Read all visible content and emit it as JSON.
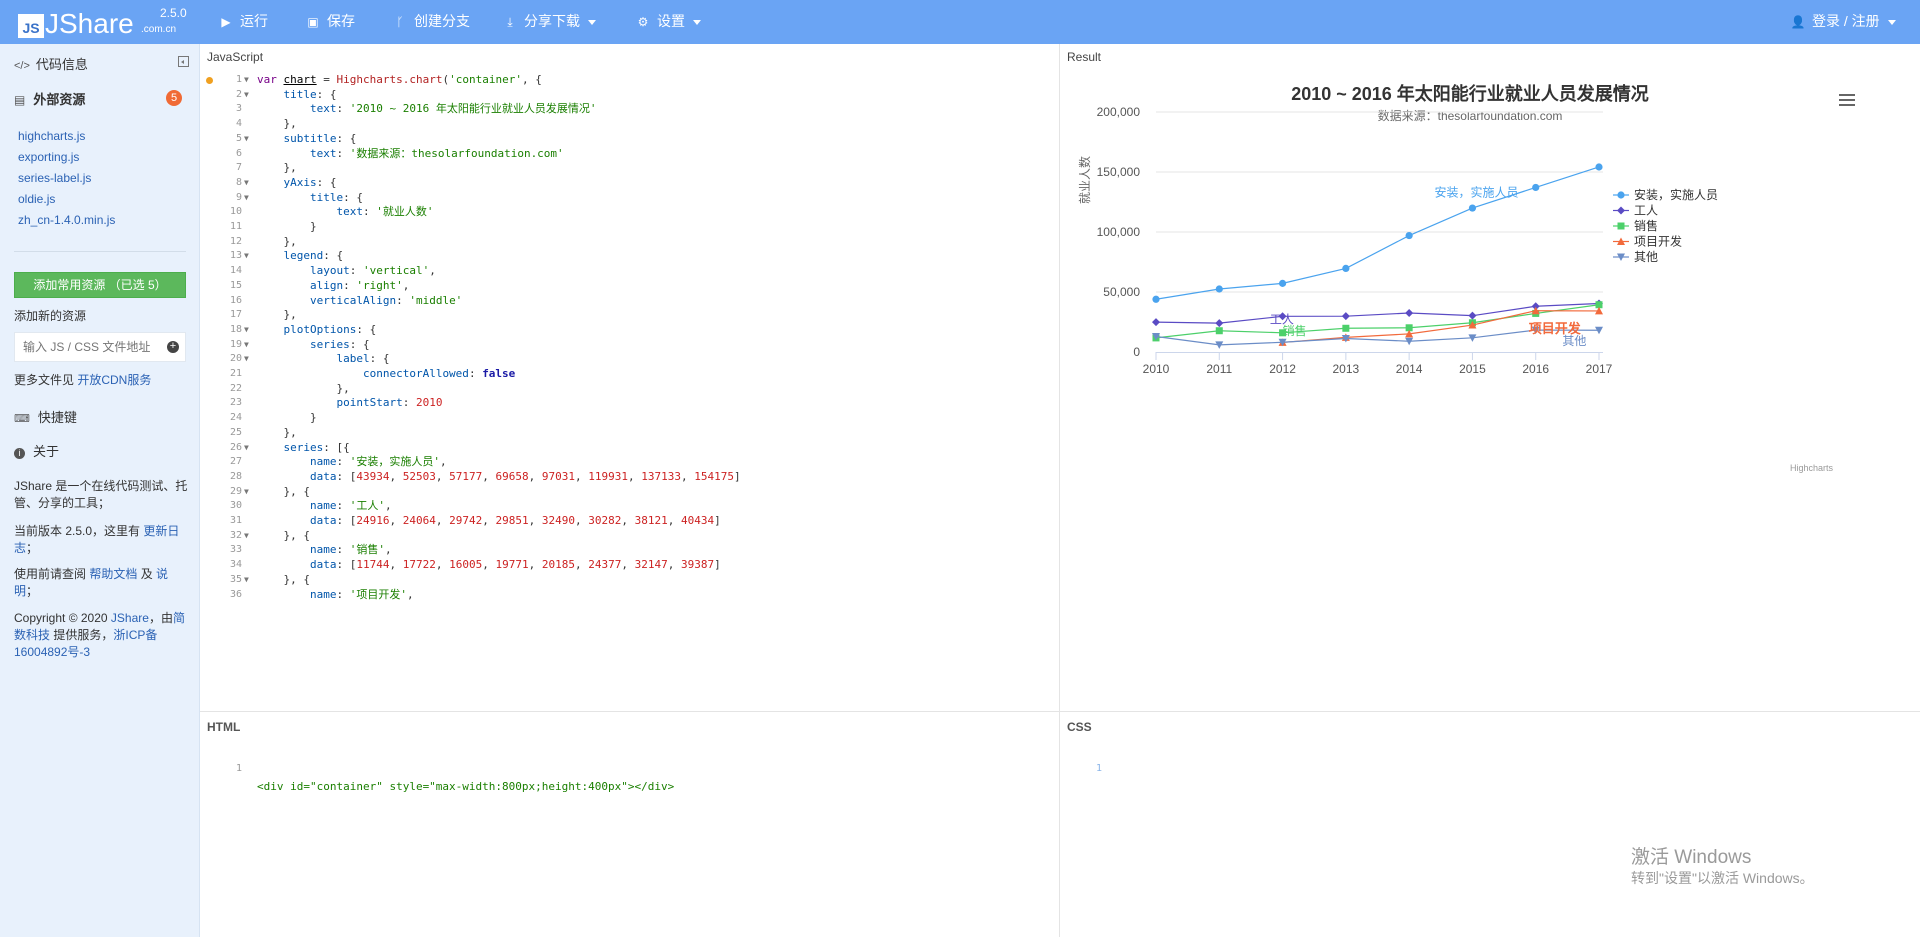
{
  "header": {
    "logo_box": "JS",
    "logo_name": "JShare",
    "logo_domain": ".com.cn",
    "version": "2.5.0",
    "nav": [
      {
        "label": "运行",
        "icon": "play-icon"
      },
      {
        "label": "保存",
        "icon": "save-icon"
      },
      {
        "label": "创建分支",
        "icon": "fork-icon"
      },
      {
        "label": "分享下载",
        "icon": "download-icon"
      },
      {
        "label": "设置",
        "icon": "gear-icon"
      }
    ],
    "login": "登录 / 注册"
  },
  "sidebar": {
    "code_info": "代码信息",
    "external_resources": "外部资源",
    "resource_count": "5",
    "resources": [
      "highcharts.js",
      "exporting.js",
      "series-label.js",
      "oldie.js",
      "zh_cn-1.4.0.min.js"
    ],
    "add_button": "添加常用资源 （已选 5）",
    "add_new": "添加新的资源",
    "input_placeholder": "输入 JS / CSS 文件地址",
    "more_files": "更多文件见 ",
    "more_files_link": "开放CDN服务",
    "shortcuts": "快捷键",
    "about": "关于",
    "about_text": "JShare 是一个在线代码测试、托管、分享的工具；",
    "version_text": "当前版本 2.5.0，这里有 ",
    "version_link": "更新日志",
    "version_end": "；",
    "help_text": "使用前请查阅 ",
    "help_link1": "帮助文档",
    "help_mid": " 及 ",
    "help_link2": "说明",
    "help_end": "；",
    "copyright_1": "Copyright © 2020 ",
    "copyright_link1": "JShare",
    "copyright_2": "，由",
    "copyright_link2": "简数科技",
    "copyright_3": " 提供服务，",
    "copyright_link3": "浙ICP备16004892号-3"
  },
  "panels": {
    "javascript": "JavaScript",
    "result": "Result",
    "html": "HTML",
    "css": "CSS"
  },
  "js_code": [
    "var chart = Highcharts.chart('container', {",
    "    title: {",
    "        text: '2010 ~ 2016 年太阳能行业就业人员发展情况'",
    "    },",
    "    subtitle: {",
    "        text: '数据来源：thesolarfoundation.com'",
    "    },",
    "    yAxis: {",
    "        title: {",
    "            text: '就业人数'",
    "        }",
    "    },",
    "    legend: {",
    "        layout: 'vertical',",
    "        align: 'right',",
    "        verticalAlign: 'middle'",
    "    },",
    "    plotOptions: {",
    "        series: {",
    "            label: {",
    "                connectorAllowed: false",
    "            },",
    "            pointStart: 2010",
    "        }",
    "    },",
    "    series: [{",
    "        name: '安装，实施人员',",
    "        data: [43934, 52503, 57177, 69658, 97031, 119931, 137133, 154175]",
    "    }, {",
    "        name: '工人',",
    "        data: [24916, 24064, 29742, 29851, 32490, 30282, 38121, 40434]",
    "    }, {",
    "        name: '销售',",
    "        data: [11744, 17722, 16005, 19771, 20185, 24377, 32147, 39387]",
    "    }, {",
    "        name: '项目开发',"
  ],
  "html_code": [
    "<div id=\"container\" style=\"max-width:800px;height:400px\"></div>"
  ],
  "css_code": [
    ""
  ],
  "chart_data": {
    "type": "line",
    "title": "2010 ~ 2016 年太阳能行业就业人员发展情况",
    "subtitle": "数据来源：thesolarfoundation.com",
    "ylabel": "就业人数",
    "xlabel": "",
    "x": [
      2010,
      2011,
      2012,
      2013,
      2014,
      2015,
      2016,
      2017
    ],
    "ylim": [
      0,
      200000
    ],
    "yticks": [
      "0",
      "50,000",
      "100,000",
      "150,000",
      "200,000"
    ],
    "grid": true,
    "legend": "right-middle",
    "credits": "Highcharts",
    "series": [
      {
        "name": "安装，实施人员",
        "color": "#4aa3ee",
        "marker": "circle",
        "values": [
          43934,
          52503,
          57177,
          69658,
          97031,
          119931,
          137133,
          154175
        ]
      },
      {
        "name": "工人",
        "color": "#5a4bc4",
        "marker": "diamond",
        "values": [
          24916,
          24064,
          29742,
          29851,
          32490,
          30282,
          38121,
          40434
        ]
      },
      {
        "name": "销售",
        "color": "#4cd06a",
        "marker": "square",
        "values": [
          11744,
          17722,
          16005,
          19771,
          20185,
          24377,
          32147,
          39387
        ]
      },
      {
        "name": "项目开发",
        "color": "#f26a3c",
        "marker": "triangle",
        "values": [
          null,
          null,
          7988,
          12169,
          15112,
          22452,
          34400,
          34227
        ]
      },
      {
        "name": "其他",
        "color": "#6b8dc7",
        "marker": "triangle-down",
        "values": [
          12908,
          5948,
          8105,
          11248,
          8989,
          11816,
          18274,
          18111
        ]
      }
    ],
    "series_labels": [
      "安装，实施人员",
      "工人",
      "销售",
      "项目开发",
      "其他"
    ]
  },
  "watermark": {
    "line1": "激活 Windows",
    "line2": "转到\"设置\"以激活 Windows。"
  }
}
